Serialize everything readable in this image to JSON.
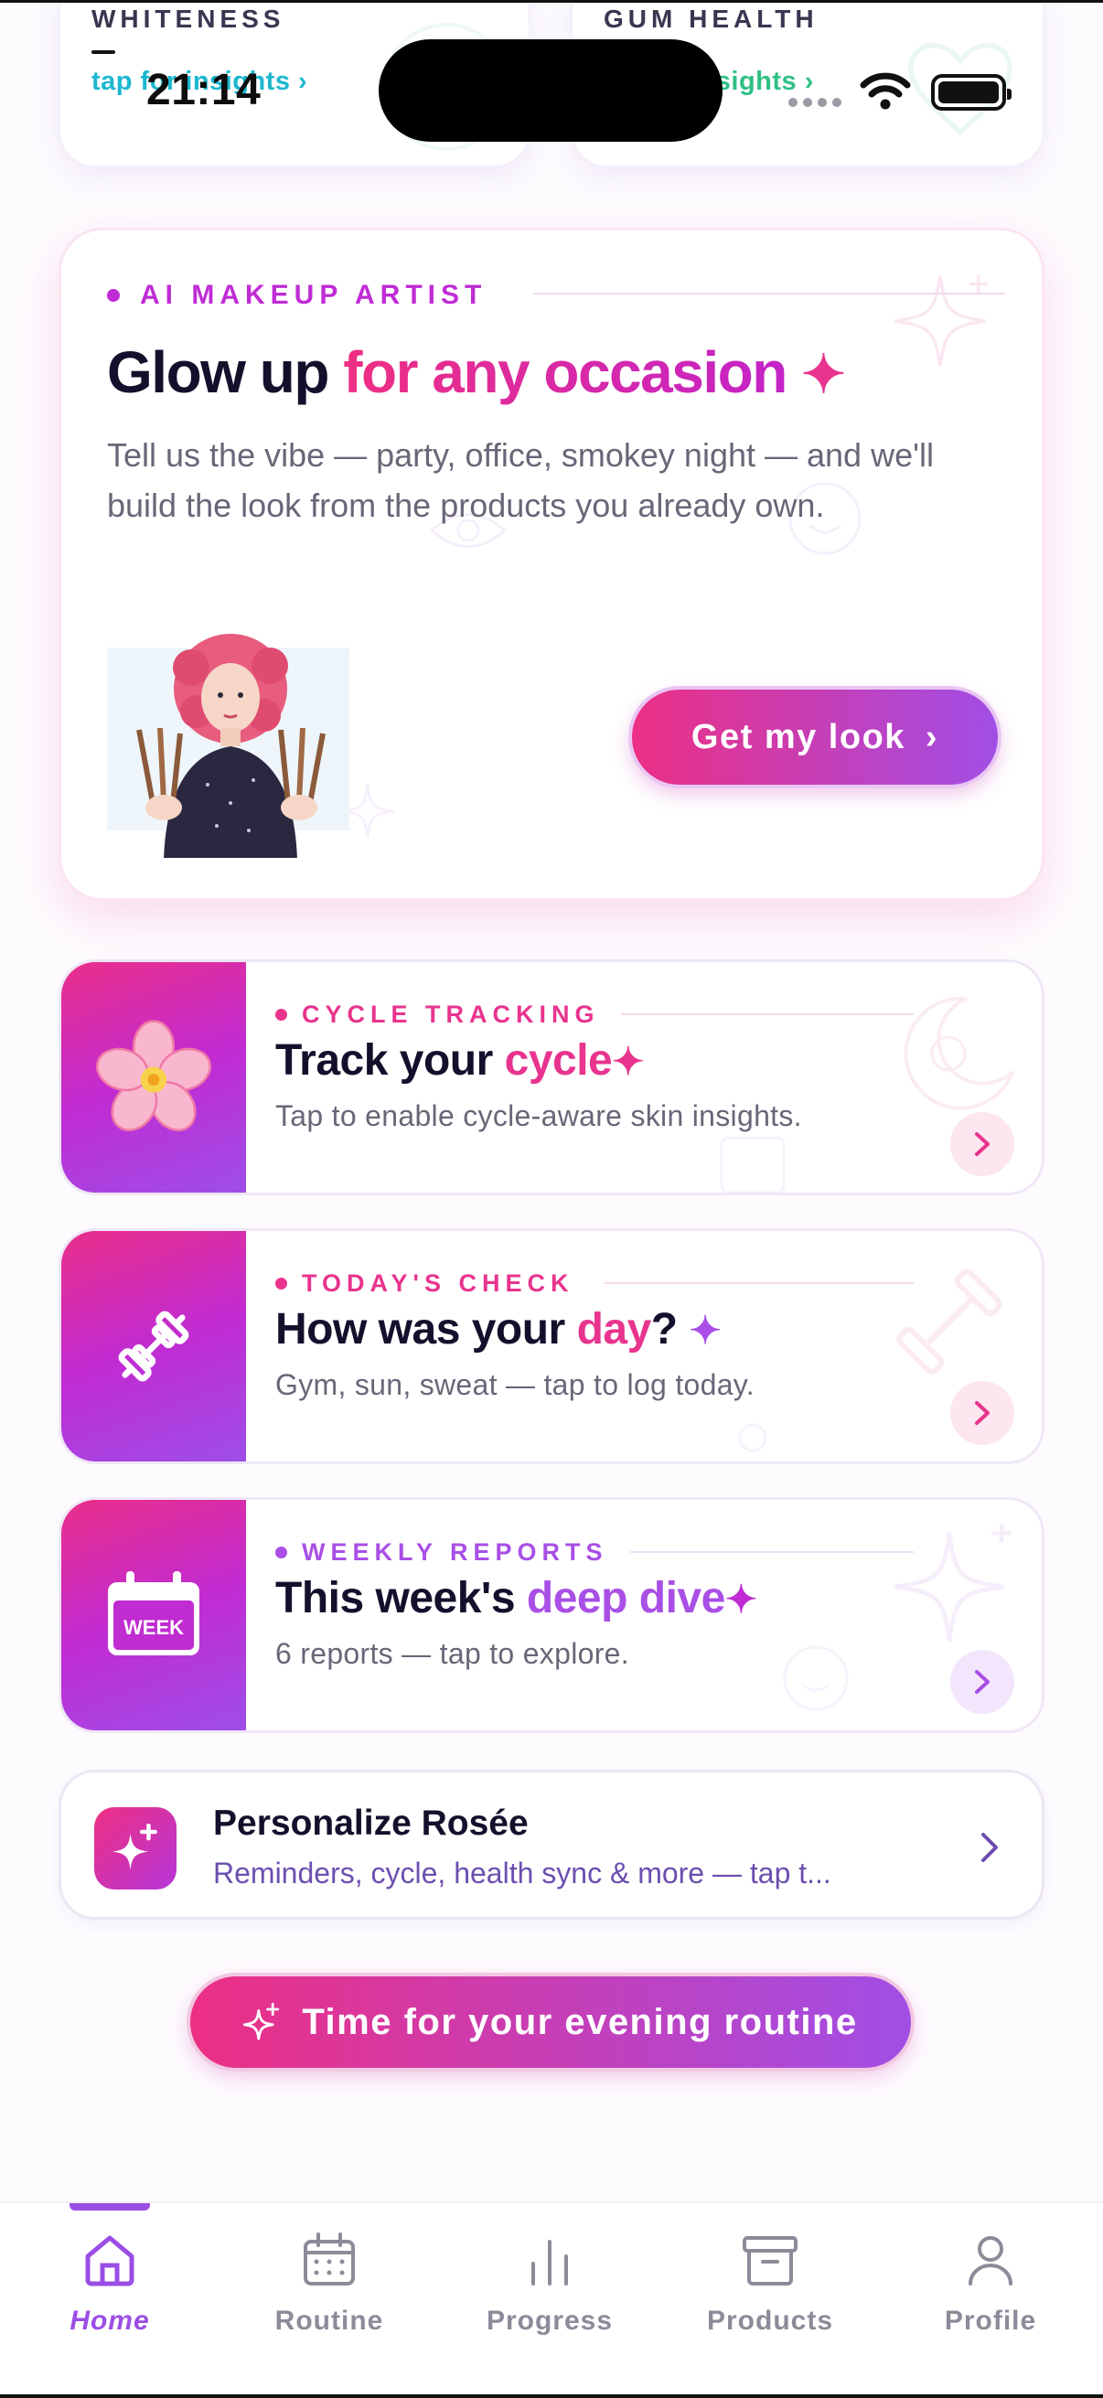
{
  "status_bar": {
    "time": "21:14"
  },
  "top_cards": [
    {
      "label": "WHITENESS",
      "link": "tap for insights ›"
    },
    {
      "label": "GUM HEALTH",
      "link": "insights ›"
    }
  ],
  "hero": {
    "kicker": "AI MAKEUP ARTIST",
    "title_plain": "Glow up ",
    "title_highlight": "for any occasion",
    "title_spark": "✦",
    "description": "Tell us the vibe — party, office, smokey night — and we'll build the look from the products you already own.",
    "button_label": "Get my look",
    "button_chevron": "›"
  },
  "features": [
    {
      "kicker": "CYCLE TRACKING",
      "title_plain": "Track your ",
      "title_highlight": "cycle",
      "title_end": "",
      "spark": "✦",
      "subtitle": "Tap to enable cycle-aware skin insights.",
      "icon": "cherry-blossom-icon",
      "accent": "#e8348e"
    },
    {
      "kicker": "TODAY'S CHECK",
      "title_plain": "How was your ",
      "title_highlight": "day",
      "title_end": "? ",
      "spark": "✦",
      "subtitle": "Gym, sun, sweat — tap to log today.",
      "icon": "dumbbell-icon",
      "accent": "#e8348e"
    },
    {
      "kicker": "WEEKLY REPORTS",
      "title_plain": "This week's ",
      "title_highlight": "deep dive",
      "title_end": "",
      "spark": "✦",
      "subtitle": "6 reports — tap to explore.",
      "icon": "calendar-week-icon",
      "icon_text": "WEEK",
      "accent": "#a94fe6"
    }
  ],
  "personalize": {
    "title": "Personalize Rosée",
    "subtitle": "Reminders, cycle, health sync & more — tap t..."
  },
  "evening_button": "Time for your evening routine",
  "tabs": [
    {
      "label": "Home",
      "active": true
    },
    {
      "label": "Routine",
      "active": false
    },
    {
      "label": "Progress",
      "active": false
    },
    {
      "label": "Products",
      "active": false
    },
    {
      "label": "Profile",
      "active": false
    }
  ],
  "colors": {
    "pink": "#ec2f84",
    "purple": "#a14ee6",
    "magenta": "#c02bd6",
    "active_tab": "#9b4ee5"
  }
}
